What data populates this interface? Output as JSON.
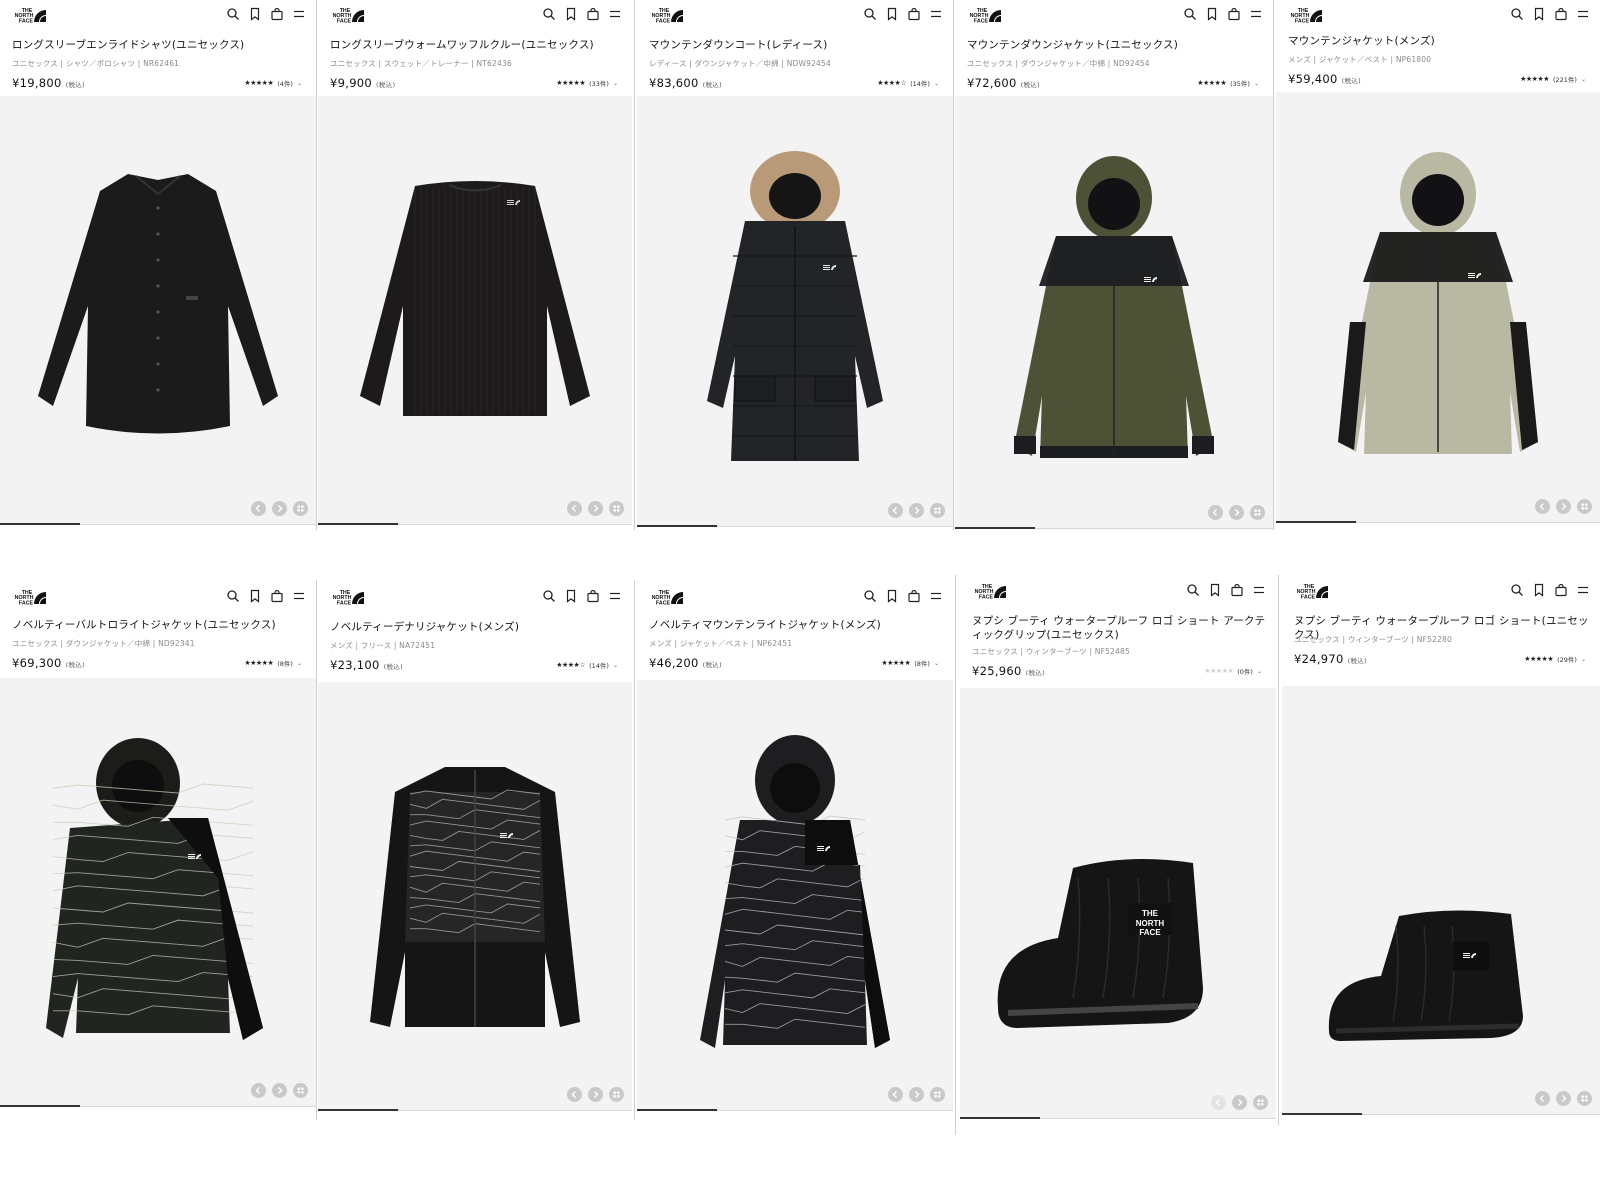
{
  "brand": {
    "logo_text": "THE NORTH FACE"
  },
  "price_tax_label": "(税込)",
  "products": [
    {
      "title": "ロングスリーブエンライドシャツ(ユニセックス)",
      "meta": "ユニセックス | シャツ／ポロシャツ | NR62461",
      "price": "¥19,800",
      "stars": "★★★★★",
      "count": "(4件)",
      "item": "shirt",
      "color": "#1b1b1b"
    },
    {
      "title": "ロングスリーブウォームワッフルクルー(ユニセックス)",
      "meta": "ユニセックス | スウェット／トレーナー | NT62436",
      "price": "¥9,900",
      "stars": "★★★★★",
      "count": "(33件)",
      "item": "sweater",
      "color": "#1d1a1b"
    },
    {
      "title": "マウンテンダウンコート(レディース)",
      "meta": "レディース | ダウンジャケット／中綿 | NDW92454",
      "price": "¥83,600",
      "stars": "★★★★☆",
      "count": "(14件)",
      "item": "coat",
      "color": "#222428"
    },
    {
      "title": "マウンテンダウンジャケット(ユニセックス)",
      "meta": "ユニセックス | ダウンジャケット／中綿 | ND92454",
      "price": "¥72,600",
      "stars": "★★★★★",
      "count": "(35件)",
      "item": "jacket-olive",
      "color": "#4d5236"
    },
    {
      "title": "マウンテンジャケット(メンズ)",
      "meta": "メンズ | ジャケット／ベスト | NP61800",
      "price": "¥59,400",
      "stars": "★★★★★",
      "count": "(221件)",
      "item": "jacket-beige",
      "color": "#b9b9a3"
    },
    {
      "title": "ノベルティーバルトロライトジャケット(ユニセックス)",
      "meta": "ユニセックス | ダウンジャケット／中綿 | ND92341",
      "price": "¥69,300",
      "stars": "★★★★★",
      "count": "(8件)",
      "item": "jacket-camo",
      "color": "#23241f"
    },
    {
      "title": "ノベルティーデナリジャケット(メンズ)",
      "meta": "メンズ | フリース | NA72451",
      "price": "¥23,100",
      "stars": "★★★★☆",
      "count": "(14件)",
      "item": "fleece",
      "color": "#151515"
    },
    {
      "title": "ノベルティマウンテンライトジャケット(メンズ)",
      "meta": "メンズ | ジャケット／ベスト | NP62451",
      "price": "¥46,200",
      "stars": "★★★★★",
      "count": "(8件)",
      "item": "jacket-print",
      "color": "#1a1a1c"
    },
    {
      "title": "ヌプシ ブーティ ウォータープルーフ ロゴ ショート アークティックグリップ(ユニセックス)",
      "meta": "ユニセックス | ウィンターブーツ | NF52485",
      "price": "¥25,960",
      "stars": "★★★★★",
      "count": "(0件)",
      "item": "boot-big",
      "color": "#151515",
      "empty": true
    },
    {
      "title": "ヌプシ ブーティ ウォータープルーフ ロゴ ショート(ユニセックス)",
      "meta": "ユニセックス | ウィンターブーツ | NF52280",
      "price": "¥24,970",
      "stars": "★★★★★",
      "count": "(29件)",
      "item": "boot-small",
      "color": "#151515"
    }
  ]
}
